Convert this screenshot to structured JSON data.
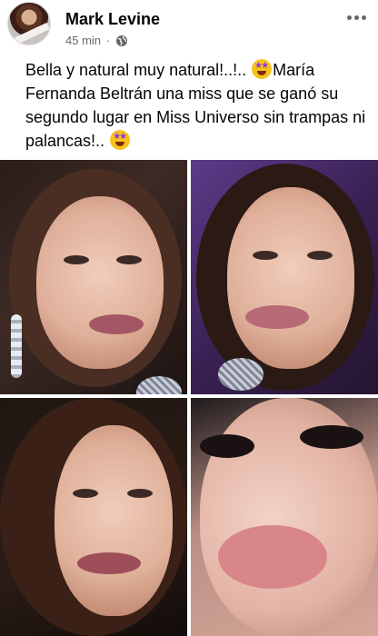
{
  "post": {
    "author_name": "Mark Levine",
    "time": "45 min",
    "separator": "·",
    "audience_icon": "globe-icon",
    "text_part1": "Bella y natural muy natural!..!.. ",
    "text_part2": "María Fernanda Beltrán una miss que se ganó su segundo lugar en Miss Universo sin trampas ni palancas!.. ",
    "emoji": "star-struck-emoji"
  },
  "colors": {
    "name": "#050505",
    "meta": "#65676b",
    "background": "#ffffff"
  },
  "photos": [
    {
      "icon": "photo-1"
    },
    {
      "icon": "photo-2"
    },
    {
      "icon": "photo-3"
    },
    {
      "icon": "photo-4"
    }
  ]
}
